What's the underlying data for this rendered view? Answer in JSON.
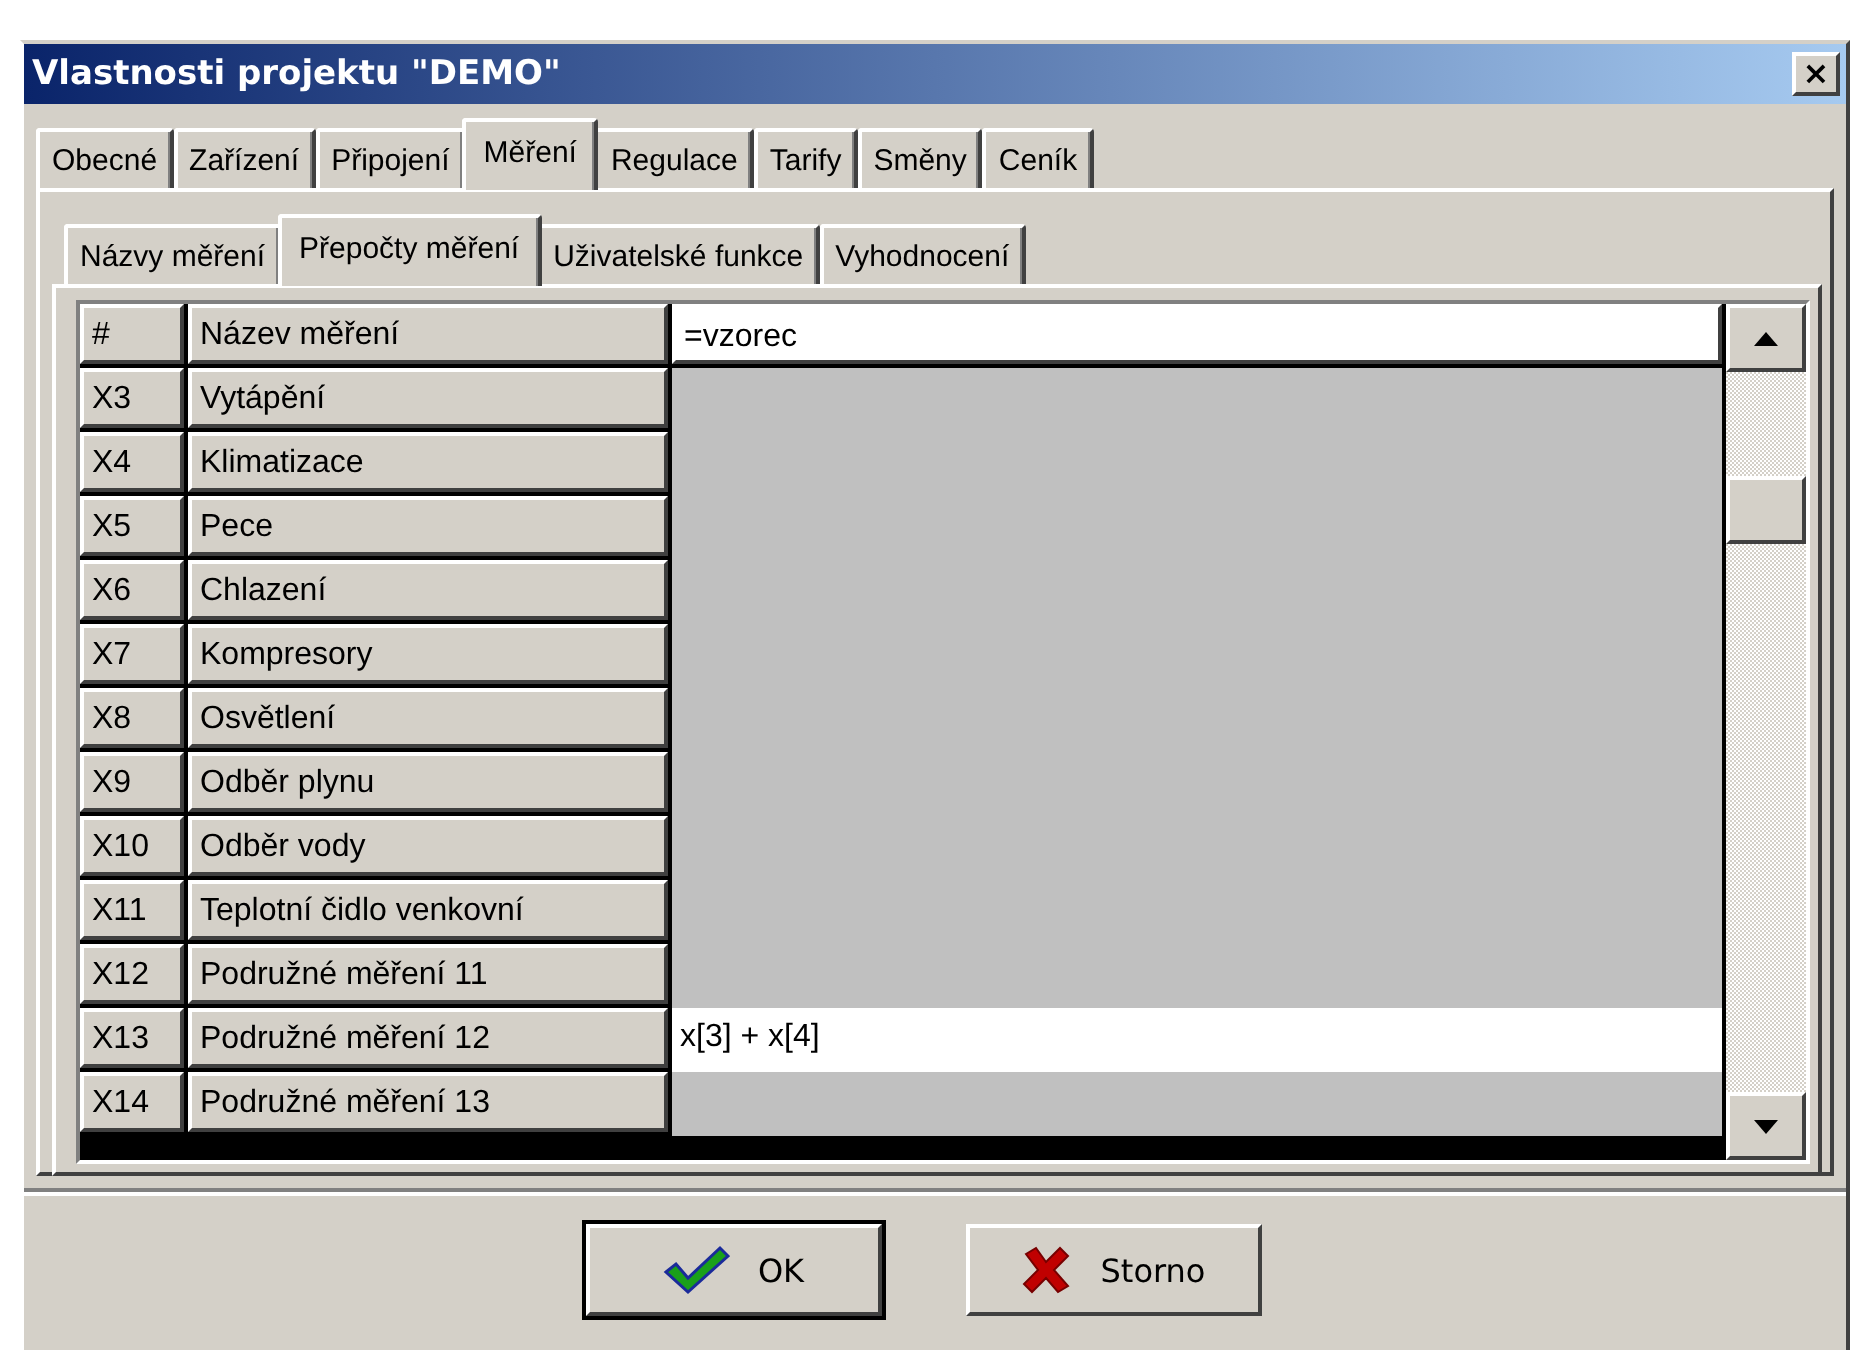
{
  "window": {
    "title": "Vlastnosti projektu \"DEMO\"",
    "close": "×"
  },
  "tabs": [
    {
      "label": "Obecné",
      "selected": false
    },
    {
      "label": "Zařízení",
      "selected": false
    },
    {
      "label": "Připojení",
      "selected": false
    },
    {
      "label": "Měření",
      "selected": true
    },
    {
      "label": "Regulace",
      "selected": false
    },
    {
      "label": "Tarify",
      "selected": false
    },
    {
      "label": "Směny",
      "selected": false
    },
    {
      "label": "Ceník",
      "selected": false
    }
  ],
  "subtabs": [
    {
      "label": "Názvy měření",
      "selected": false
    },
    {
      "label": "Přepočty měření",
      "selected": true
    },
    {
      "label": "Uživatelské funkce",
      "selected": false
    },
    {
      "label": "Vyhodnocení",
      "selected": false
    }
  ],
  "table": {
    "columns": [
      "#",
      "Název měření",
      "=vzorec"
    ],
    "rows": [
      {
        "id": "X3",
        "name": "Vytápění"
      },
      {
        "id": "X4",
        "name": "Klimatizace"
      },
      {
        "id": "X5",
        "name": "Pece"
      },
      {
        "id": "X6",
        "name": "Chlazení"
      },
      {
        "id": "X7",
        "name": "Kompresory"
      },
      {
        "id": "X8",
        "name": "Osvětlení"
      },
      {
        "id": "X9",
        "name": "Odběr plynu"
      },
      {
        "id": "X10",
        "name": "Odběr vody"
      },
      {
        "id": "X11",
        "name": "Teplotní čidlo venkovní"
      },
      {
        "id": "X12",
        "name": "Podružné měření 11"
      },
      {
        "id": "X13",
        "name": "Podružné měření 12",
        "formula": "x[3] + x[4]"
      },
      {
        "id": "X14",
        "name": "Podružné měření 13"
      }
    ]
  },
  "buttons": [
    {
      "label": "OK",
      "kind": "ok"
    },
    {
      "label": "Storno",
      "kind": "cancel"
    }
  ]
}
